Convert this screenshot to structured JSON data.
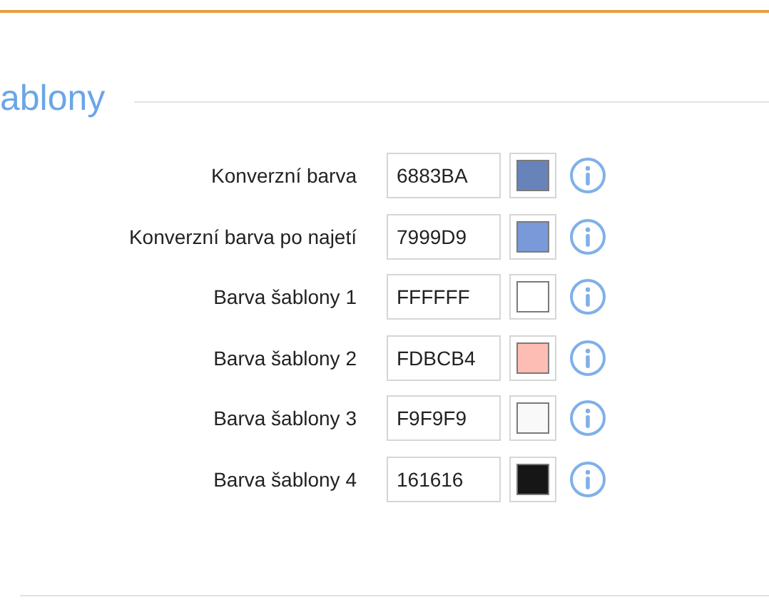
{
  "section": {
    "title": "ablony"
  },
  "rows": [
    {
      "label": "Konverzní barva",
      "value": "6883BA",
      "color": "#6883ba"
    },
    {
      "label": "Konverzní barva po najetí",
      "value": "7999D9",
      "color": "#7999d9"
    },
    {
      "label": "Barva šablony 1",
      "value": "FFFFFF",
      "color": "#ffffff"
    },
    {
      "label": "Barva šablony 2",
      "value": "FDBCB4",
      "color": "#fdbcb4"
    },
    {
      "label": "Barva šablony 3",
      "value": "F9F9F9",
      "color": "#f9f9f9"
    },
    {
      "label": "Barva šablony 4",
      "value": "161616",
      "color": "#161616"
    }
  ]
}
